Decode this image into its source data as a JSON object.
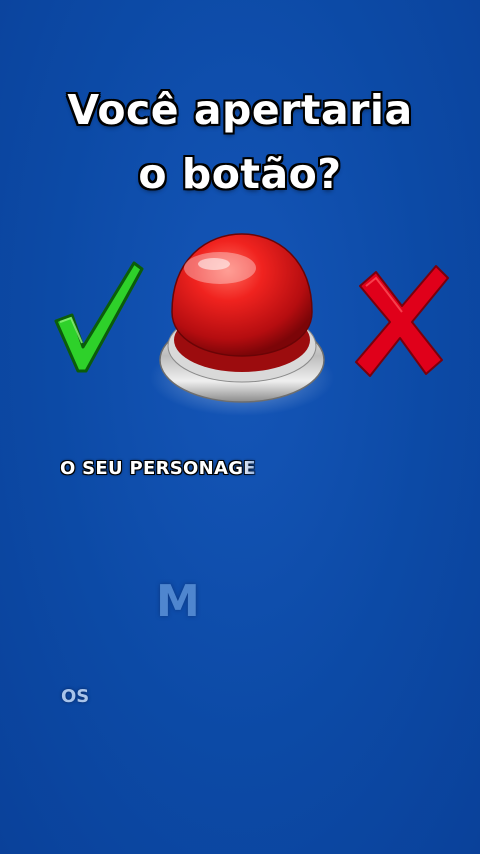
{
  "title": {
    "line1": "Você apertaria",
    "line2": "o botão?"
  },
  "icons": {
    "yes": "green-checkmark-icon",
    "button": "red-push-button-icon",
    "no": "red-x-icon"
  },
  "caption": {
    "text": "O SEU PERSONAGE",
    "letter": "M",
    "next_word": "OS"
  },
  "colors": {
    "background": "#0c4aa6",
    "check": "#2ed12a",
    "cross": "#e0001a",
    "button_red": "#e0171b"
  }
}
